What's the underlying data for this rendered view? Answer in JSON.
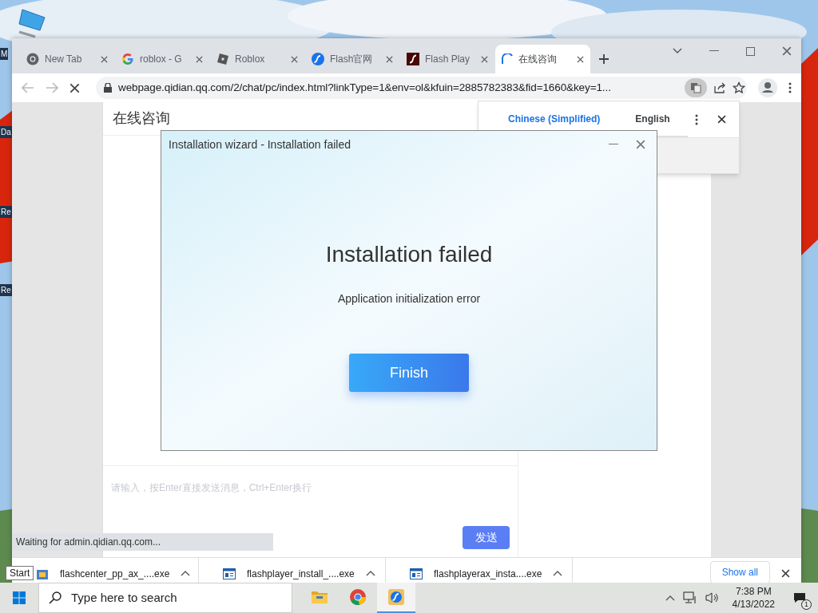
{
  "desktop": {
    "icon_labels": [
      "M",
      "Da",
      "Re",
      "Re"
    ]
  },
  "browser": {
    "tabs": [
      {
        "title": "New Tab",
        "kind": "chrome",
        "selected": false
      },
      {
        "title": "roblox - G",
        "kind": "google",
        "selected": false
      },
      {
        "title": "Roblox",
        "kind": "roblox",
        "selected": false
      },
      {
        "title": "Flash官网",
        "kind": "flash",
        "selected": false
      },
      {
        "title": "Flash Play",
        "kind": "flash-red",
        "selected": false
      },
      {
        "title": "在线咨询",
        "kind": "loading",
        "selected": true
      }
    ],
    "url": "webpage.qidian.qq.com/2/chat/pc/index.html?linkType=1&env=ol&kfuin=2885782383&fid=1660&key=1...",
    "translate_popup": {
      "languages": [
        {
          "label": "Chinese (Simplified)",
          "selected": true
        },
        {
          "label": "English",
          "selected": false
        }
      ]
    },
    "page": {
      "chat_title": "在线咨询",
      "input_placeholder": "请输入，按Enter直接发送消息，Ctrl+Enter换行",
      "send_button": "发送"
    },
    "status": "Waiting for admin.qidian.qq.com...",
    "downloads": [
      {
        "name": "flashcenter_pp_ax_....exe",
        "kind": "installer"
      },
      {
        "name": "flashplayer_install_....exe",
        "kind": "window"
      },
      {
        "name": "flashplayerax_insta....exe",
        "kind": "window"
      }
    ],
    "show_all": "Show all"
  },
  "dialog": {
    "title": "Installation wizard - Installation failed",
    "heading": "Installation failed",
    "message": "Application initialization error",
    "button": "Finish"
  },
  "taskbar": {
    "tooltip": "Start",
    "search_placeholder": "Type here to search",
    "apps": [
      {
        "kind": "folder",
        "selected": false
      },
      {
        "kind": "chrome",
        "selected": false
      },
      {
        "kind": "flash",
        "selected": true
      }
    ],
    "time": "7:38 PM",
    "date": "4/13/2022",
    "notifications": "1"
  }
}
